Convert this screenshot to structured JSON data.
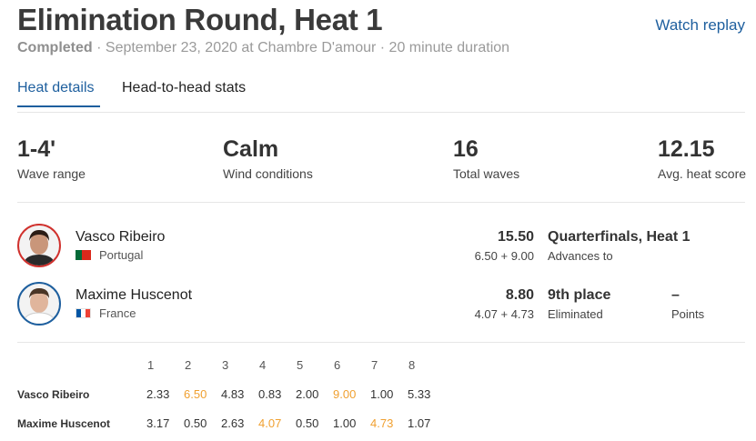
{
  "header": {
    "title": "Elimination Round, Heat 1",
    "replay_label": "Watch replay",
    "status": "Completed",
    "details": " · September 23, 2020 at Chambre D'amour · 20 minute duration"
  },
  "tabs": [
    {
      "label": "Heat details",
      "active": true
    },
    {
      "label": "Head-to-head stats",
      "active": false
    }
  ],
  "stats": [
    {
      "value": "1-4'",
      "label": "Wave range"
    },
    {
      "value": "Calm",
      "label": "Wind conditions"
    },
    {
      "value": "16",
      "label": "Total waves"
    },
    {
      "value": "12.15",
      "label": "Avg. heat score"
    }
  ],
  "athletes": [
    {
      "name": "Vasco Ribeiro",
      "country": "Portugal",
      "ring_color": "#d0312d",
      "total": "15.50",
      "breakdown": "6.50 + 9.00",
      "result": "Quarterfinals, Heat 1",
      "result_sub": "Advances to",
      "points": "",
      "points_sub": ""
    },
    {
      "name": "Maxime Huscenot",
      "country": "France",
      "ring_color": "#1e5f9e",
      "total": "8.80",
      "breakdown": "4.07 + 4.73",
      "result": "9th place",
      "result_sub": "Eliminated",
      "points": "–",
      "points_sub": "Points"
    }
  ],
  "wave_table": {
    "waves": [
      "1",
      "2",
      "3",
      "4",
      "5",
      "6",
      "7",
      "8"
    ],
    "rows": [
      {
        "name": "Vasco Ribeiro",
        "scores": [
          "2.33",
          "6.50",
          "4.83",
          "0.83",
          "2.00",
          "9.00",
          "1.00",
          "5.33"
        ],
        "best": [
          1,
          5
        ]
      },
      {
        "name": "Maxime Huscenot",
        "scores": [
          "3.17",
          "0.50",
          "2.63",
          "4.07",
          "0.50",
          "1.00",
          "4.73",
          "1.07"
        ],
        "best": [
          3,
          6
        ]
      }
    ]
  },
  "colors": {
    "accent": "#1e5f9e",
    "best_wave": "#f0a030"
  }
}
